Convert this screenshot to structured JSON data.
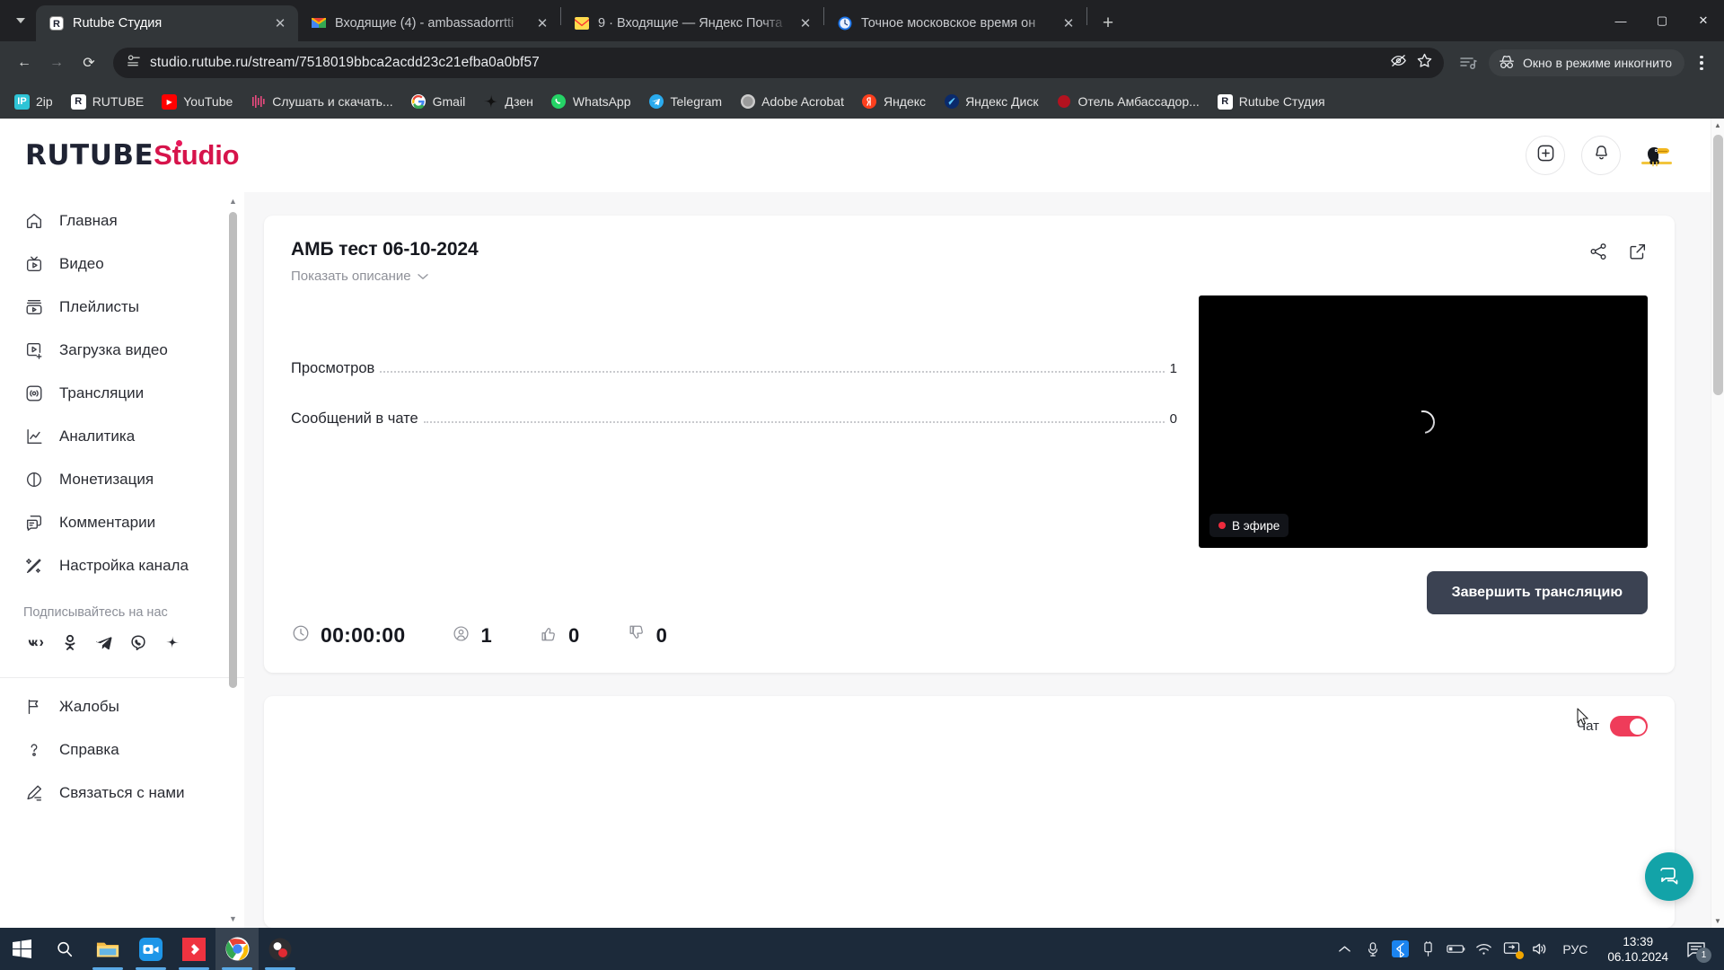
{
  "browser": {
    "tabs": [
      {
        "title": "Rutube Студия",
        "favicon": "rutube-icon",
        "active": true
      },
      {
        "title": "Входящие (4) - ambassadorrtti",
        "favicon": "gmail-icon",
        "active": false
      },
      {
        "title": "9 · Входящие — Яндекс Почта",
        "favicon": "yandex-mail-icon",
        "active": false
      },
      {
        "title": "Точное московское время он",
        "favicon": "clock-icon",
        "active": false
      }
    ],
    "new_tab_label": "+",
    "window_controls": {
      "minimize": "—",
      "maximize": "▢",
      "close": "✕"
    },
    "nav": {
      "back": "←",
      "forward": "→",
      "reload": "⟳"
    },
    "url": "studio.rutube.ru/stream/7518019bbca2acdd23c21efba0a0bf57",
    "incognito_label": "Окно в режиме инкогнито",
    "bookmarks": [
      {
        "label": "2ip",
        "icon": "2ip-icon"
      },
      {
        "label": "RUTUBE",
        "icon": "rutube-icon"
      },
      {
        "label": "YouTube",
        "icon": "youtube-icon"
      },
      {
        "label": "Слушать и скачать...",
        "icon": "music-icon"
      },
      {
        "label": "Gmail",
        "icon": "gmail-icon"
      },
      {
        "label": "Дзен",
        "icon": "dzen-icon"
      },
      {
        "label": "WhatsApp",
        "icon": "whatsapp-icon"
      },
      {
        "label": "Telegram",
        "icon": "telegram-icon"
      },
      {
        "label": "Adobe Acrobat",
        "icon": "acrobat-icon"
      },
      {
        "label": "Яндекс",
        "icon": "yandex-icon"
      },
      {
        "label": "Яндекс Диск",
        "icon": "yandex-disk-icon"
      },
      {
        "label": "Отель Амбассадор...",
        "icon": "hotel-icon"
      },
      {
        "label": "Rutube Студия",
        "icon": "rutube-icon"
      }
    ]
  },
  "app": {
    "logo": {
      "part1": "RUTUBE",
      "part2": "Studio",
      "color_primary": "#1f2333",
      "color_accent": "#d6144b"
    },
    "header_actions": [
      {
        "name": "create-button",
        "icon": "plus-square-icon"
      },
      {
        "name": "notifications-button",
        "icon": "bell-icon"
      }
    ],
    "avatar_alt": "toucan-avatar"
  },
  "sidebar": {
    "items": [
      {
        "label": "Главная",
        "icon": "home-icon"
      },
      {
        "label": "Видео",
        "icon": "tv-icon"
      },
      {
        "label": "Плейлисты",
        "icon": "playlist-icon"
      },
      {
        "label": "Загрузка видео",
        "icon": "upload-video-icon"
      },
      {
        "label": "Трансляции",
        "icon": "broadcast-icon"
      },
      {
        "label": "Аналитика",
        "icon": "analytics-icon"
      },
      {
        "label": "Монетизация",
        "icon": "monetization-icon"
      },
      {
        "label": "Комментарии",
        "icon": "comments-icon"
      },
      {
        "label": "Настройка канала",
        "icon": "channel-settings-icon"
      }
    ],
    "follow_title": "Подписывайтесь на нас",
    "socials": [
      {
        "name": "vk-icon",
        "glyph": "VK"
      },
      {
        "name": "odnoklassniki-icon",
        "glyph": "OK"
      },
      {
        "name": "telegram-icon",
        "glyph": "TG"
      },
      {
        "name": "viber-icon",
        "glyph": "VB"
      },
      {
        "name": "dzen-icon",
        "glyph": "DZ"
      }
    ],
    "bottom_items": [
      {
        "label": "Жалобы",
        "icon": "flag-icon"
      },
      {
        "label": "Справка",
        "icon": "help-icon"
      },
      {
        "label": "Связаться с нами",
        "icon": "contact-us-icon"
      }
    ]
  },
  "stream": {
    "title": "АМБ тест 06-10-2024",
    "description_toggle": "Показать описание",
    "share_icon": "share-icon",
    "open_icon": "external-link-icon",
    "stats": [
      {
        "label": "Просмотров",
        "value": "1"
      },
      {
        "label": "Сообщений в чате",
        "value": "0"
      }
    ],
    "live_badge": "В эфире",
    "end_button": "Завершить трансляцию",
    "footer": [
      {
        "name": "duration",
        "icon": "clock-icon",
        "value": "00:00:00"
      },
      {
        "name": "viewers",
        "icon": "viewer-icon",
        "value": "1"
      },
      {
        "name": "likes",
        "icon": "thumbs-up-icon",
        "value": "0"
      },
      {
        "name": "dislikes",
        "icon": "thumbs-down-icon",
        "value": "0"
      }
    ]
  },
  "chat": {
    "label": "Чат",
    "enabled": true,
    "toggle_color": "#ef3c5a"
  },
  "support": {
    "icon": "chat-bubble-icon",
    "color": "#13a3a8"
  },
  "taskbar": {
    "items": [
      {
        "name": "start-button",
        "icon": "windows-icon"
      },
      {
        "name": "search-button",
        "icon": "search-icon"
      },
      {
        "name": "file-explorer",
        "icon": "folder-icon"
      },
      {
        "name": "camera-app",
        "icon": "camera-icon"
      },
      {
        "name": "anydesk-app",
        "icon": "anydesk-icon"
      },
      {
        "name": "chrome-app",
        "icon": "chrome-icon"
      },
      {
        "name": "obs-app",
        "icon": "obs-icon"
      }
    ],
    "tray": [
      {
        "name": "show-hidden-icons",
        "icon": "chevron-up-icon"
      },
      {
        "name": "microphone-icon",
        "icon": "microphone-icon"
      },
      {
        "name": "bluetooth-icon",
        "icon": "bluetooth-icon"
      },
      {
        "name": "usb-icon",
        "icon": "usb-icon"
      },
      {
        "name": "battery-icon",
        "icon": "battery-icon"
      },
      {
        "name": "wifi-icon",
        "icon": "wifi-icon"
      },
      {
        "name": "display-icon",
        "icon": "display-icon"
      },
      {
        "name": "volume-icon",
        "icon": "volume-icon"
      }
    ],
    "language": "РУС",
    "time": "13:39",
    "date": "06.10.2024",
    "notification_count": "1"
  }
}
